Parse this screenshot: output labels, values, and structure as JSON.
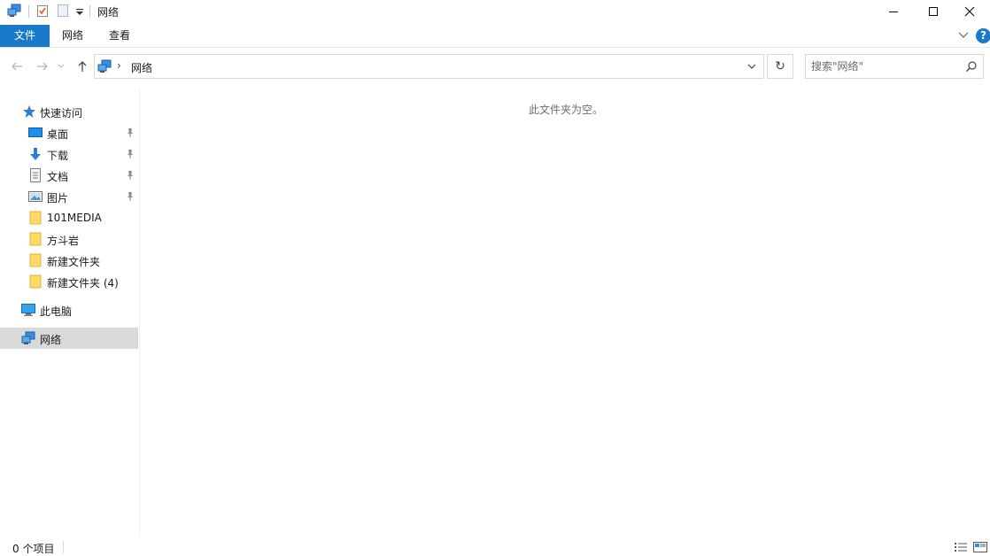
{
  "window": {
    "title": "网络",
    "controls": {
      "minimize": "—",
      "maximize": "☐",
      "close": "✕"
    }
  },
  "ribbon": {
    "tabs": [
      {
        "label": "文件",
        "active": true
      },
      {
        "label": "网络"
      },
      {
        "label": "查看"
      }
    ],
    "help_label": "?"
  },
  "address": {
    "breadcrumb_separator": "›",
    "path": [
      {
        "label": "网络",
        "icon": "network-icon"
      }
    ],
    "refresh_glyph": "↻"
  },
  "search": {
    "placeholder": "搜索\"网络\"",
    "value": ""
  },
  "nav": {
    "quick_access": {
      "label": "快速访问",
      "icon": "star-icon"
    },
    "pinned": [
      {
        "label": "桌面",
        "icon": "desktop-icon"
      },
      {
        "label": "下载",
        "icon": "download-icon"
      },
      {
        "label": "文档",
        "icon": "document-icon"
      },
      {
        "label": "图片",
        "icon": "picture-icon"
      }
    ],
    "folders": [
      {
        "label": "101MEDIA"
      },
      {
        "label": "方斗岩"
      },
      {
        "label": "新建文件夹"
      },
      {
        "label": "新建文件夹 (4)"
      }
    ],
    "this_pc": {
      "label": "此电脑",
      "icon": "computer-icon"
    },
    "network": {
      "label": "网络",
      "icon": "network-icon",
      "selected": true
    }
  },
  "content": {
    "empty_message": "此文件夹为空。"
  },
  "status": {
    "item_count": "0 个项目"
  },
  "colors": {
    "accent": "#1979ca",
    "selected": "#d9d9d9",
    "folder": "#ffd96b"
  }
}
